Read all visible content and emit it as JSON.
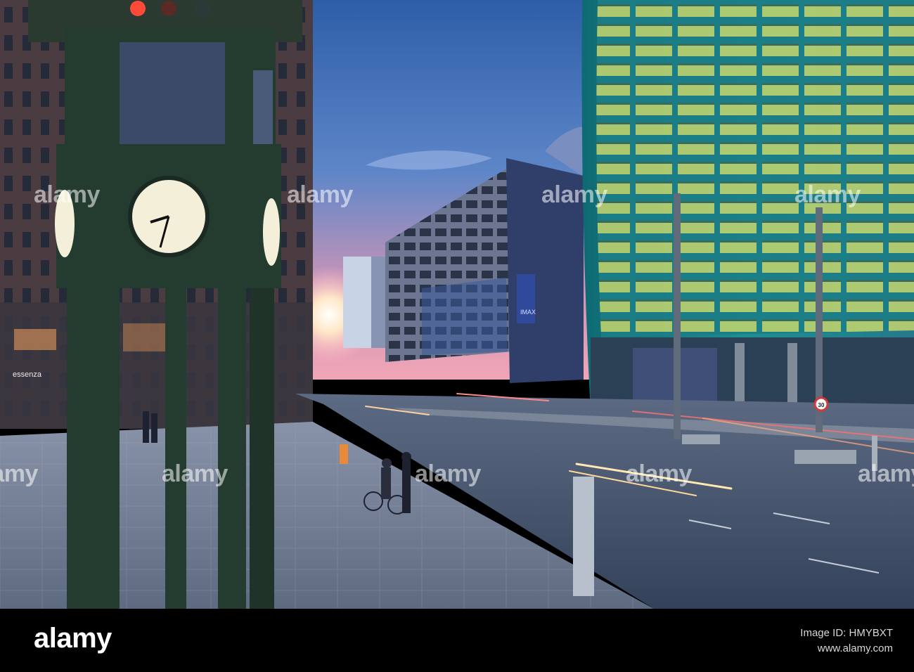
{
  "scene": {
    "clock_face": "clock-icon",
    "shop_sign": "essenza",
    "cinema_sign": "IMAX",
    "speed_limit": "30"
  },
  "watermark": {
    "text": "alamy"
  },
  "footer": {
    "brand": "alamy",
    "image_id_line": "Image ID: HMYBXT",
    "site": "www.alamy.com"
  },
  "colors": {
    "sky_top": "#2e5ea8",
    "sunset": "#f1a5b6",
    "clock_green": "#243b2f",
    "glass_teal": "#1d8e93",
    "window_yellow": "#e6e16a"
  }
}
